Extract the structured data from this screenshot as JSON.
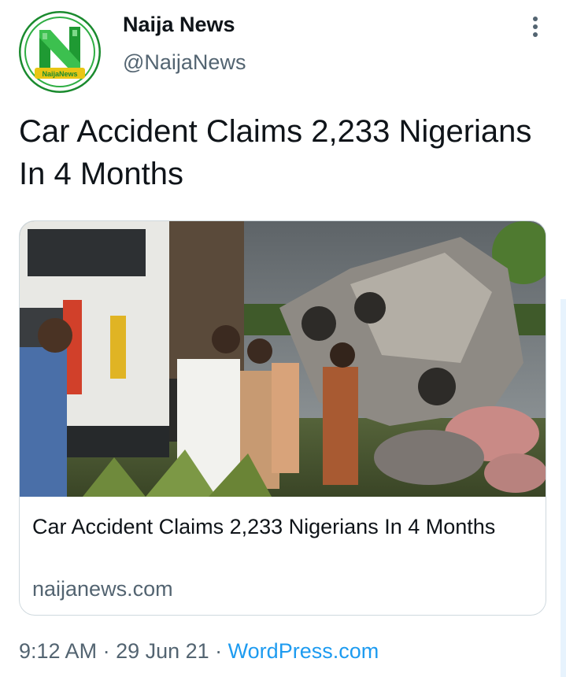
{
  "author": {
    "name": "Naija News",
    "handle": "@NaijaNews",
    "avatar_badge_text": "NaijaNews",
    "avatar_icon": "naija-news-logo"
  },
  "tweet": {
    "text": "Car Accident Claims 2,233 Nigerians In 4 Months"
  },
  "card": {
    "title": "Car Accident Claims 2,233 Nigerians In 4 Months",
    "domain": "naijanews.com",
    "image_subject": "overturned trucks at accident scene with onlookers"
  },
  "meta": {
    "time": "9:12 AM",
    "separator": " · ",
    "date": "29 Jun 21",
    "source": "WordPress.com"
  },
  "icons": {
    "more": "vertical-dots-icon"
  },
  "colors": {
    "primary_text": "#0f1419",
    "secondary_text": "#536471",
    "link": "#1d9bf0",
    "brand_green": "#1a8a2e"
  }
}
